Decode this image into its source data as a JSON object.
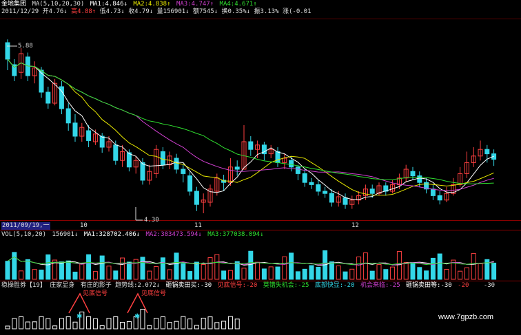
{
  "price_header": {
    "stock_name": "金地集团",
    "ma_title": "MA(5,10,20,30)",
    "ma1": "MA1:4.846↓",
    "ma2": "MA2:4.838↑",
    "ma3": "MA3:4.747↑",
    "ma4": "MA4:4.671↑"
  },
  "quote_line": {
    "date": "2011/12/29",
    "open": "开4.76↓",
    "high": "高4.88↑",
    "low": "低4.73↓",
    "close": "收4.79↓",
    "volume": "量156901↓",
    "amount": "额7545↓",
    "turnover": "换0.35%↓",
    "amplitude": "振3.13%",
    "change": "涨(-0.01"
  },
  "price_labels": {
    "high": "5.88",
    "low": "4.30"
  },
  "date_axis": {
    "start": "2011/09/19,一",
    "m10": "10",
    "m11": "11",
    "m12": "12"
  },
  "volume_header": {
    "title": "VOL(5,10,20)",
    "value": "156901↓",
    "ma1": "MA1:328702.406↓",
    "ma2": "MA2:383473.594↓",
    "ma3": "MA3:377038.094↓"
  },
  "indicator_header": {
    "name": "稳操胜券【19】",
    "i1": "庄家显身",
    "i2": "有庄的影子",
    "i3": "趋势线:2.072↓",
    "i4": "砸锅卖田买:-30",
    "i5": "见底信号:-20",
    "i6": "莫错失机会:-25",
    "i7": "底部快显:-20",
    "i8": "机会来临:-25",
    "i9": "砸锅卖田等:-30",
    "i10": "-20",
    "i11": "-30"
  },
  "signals": {
    "s1": "见底信号",
    "s2": "见底信号"
  },
  "watermark": "www.7gpzb.com",
  "colors": {
    "up": "#ff4040",
    "down": "#33d7e8",
    "ma1": "#ffffff",
    "ma2": "#e8e800",
    "ma3": "#d040d0",
    "ma4": "#30e030",
    "grid": "#8a0000"
  }
}
